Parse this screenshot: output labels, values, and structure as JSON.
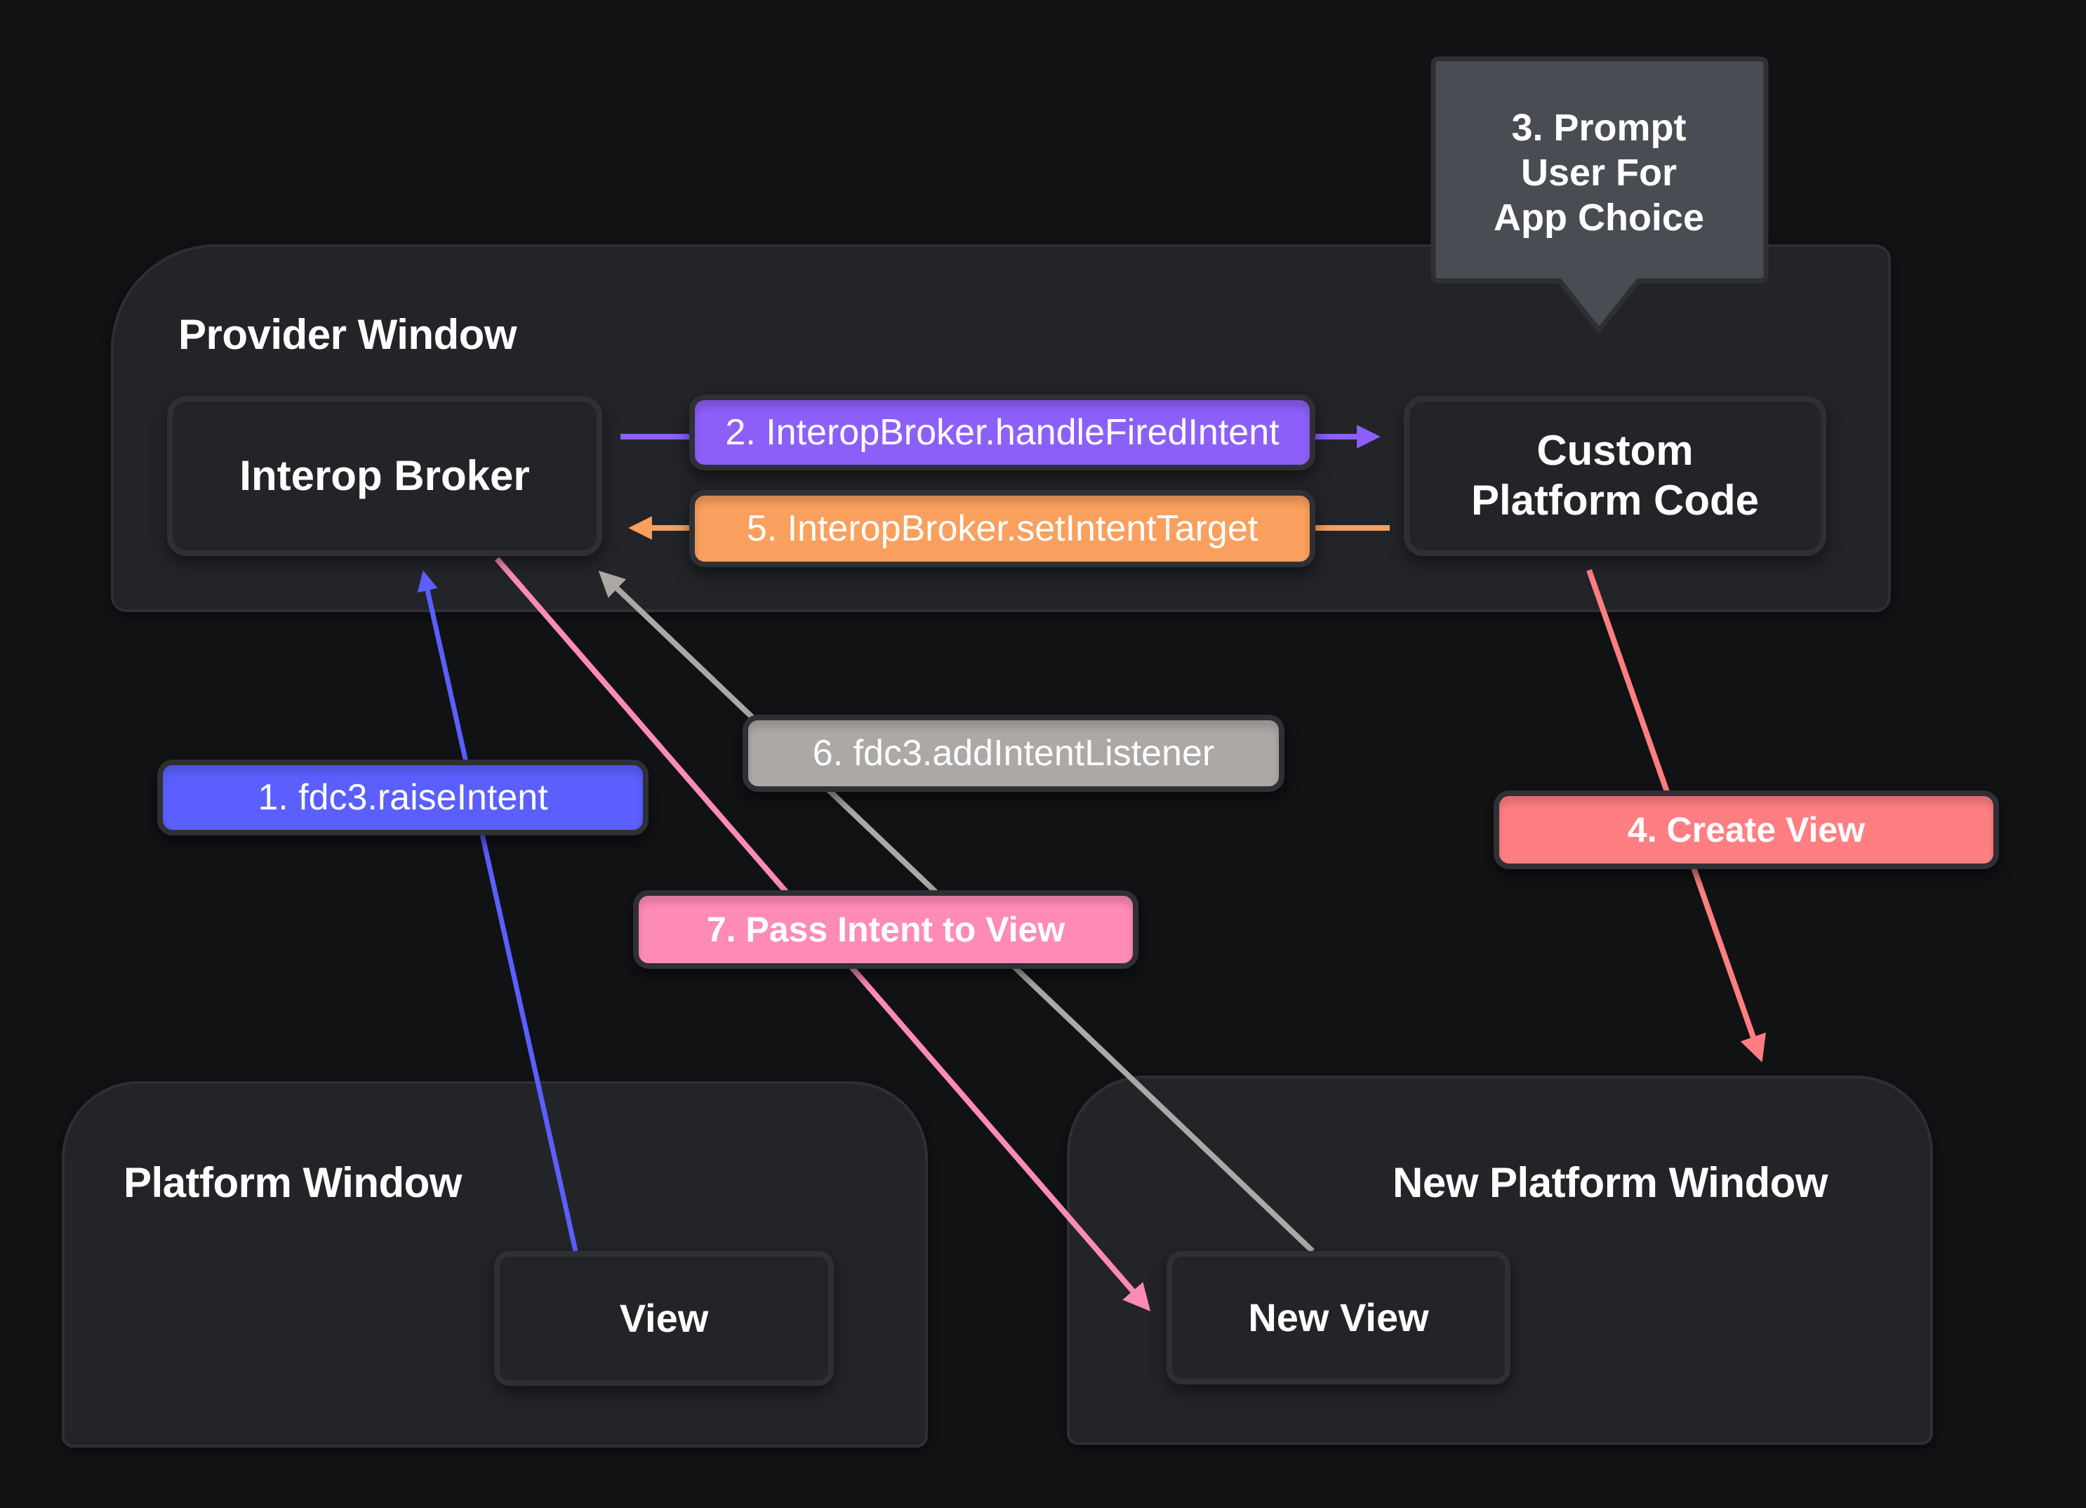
{
  "windows": {
    "provider": {
      "title": "Provider Window"
    },
    "platform": {
      "title": "Platform Window"
    },
    "new_platform": {
      "title": "New Platform Window"
    }
  },
  "nodes": {
    "interop_broker": "Interop Broker",
    "custom_platform_code": [
      "Custom",
      "Platform Code"
    ],
    "view": "View",
    "new_view": "New View"
  },
  "callout": {
    "lines": [
      "3. Prompt",
      "User For",
      "App Choice"
    ]
  },
  "steps": [
    {
      "id": "step1",
      "label": "1. fdc3.raiseIntent",
      "color": "#5a5ffe",
      "from": "View",
      "to": "Interop Broker"
    },
    {
      "id": "step2",
      "label": "2. InteropBroker.handleFiredIntent",
      "color": "#8c5ff8",
      "from": "Interop Broker",
      "to": "Custom Platform Code"
    },
    {
      "id": "step3",
      "label": "3. Prompt User For App Choice",
      "color": "#4a4c54"
    },
    {
      "id": "step4",
      "label": "4. Create View",
      "color": "#ff7e81",
      "from": "Custom Platform Code",
      "to": "New Platform Window"
    },
    {
      "id": "step5",
      "label": "5. InteropBroker.setIntentTarget",
      "color": "#f9a05e",
      "from": "Custom Platform Code",
      "to": "Interop Broker"
    },
    {
      "id": "step6",
      "label": "6. fdc3.addIntentListener",
      "color": "#aba8a6",
      "from": "New View",
      "to": "Interop Broker"
    },
    {
      "id": "step7",
      "label": "7. Pass Intent to View",
      "color": "#fe8bb7",
      "from": "Interop Broker",
      "to": "New View"
    }
  ],
  "colors": {
    "background": "#111214",
    "window_fill": "#232428",
    "border": "#2f3036"
  }
}
